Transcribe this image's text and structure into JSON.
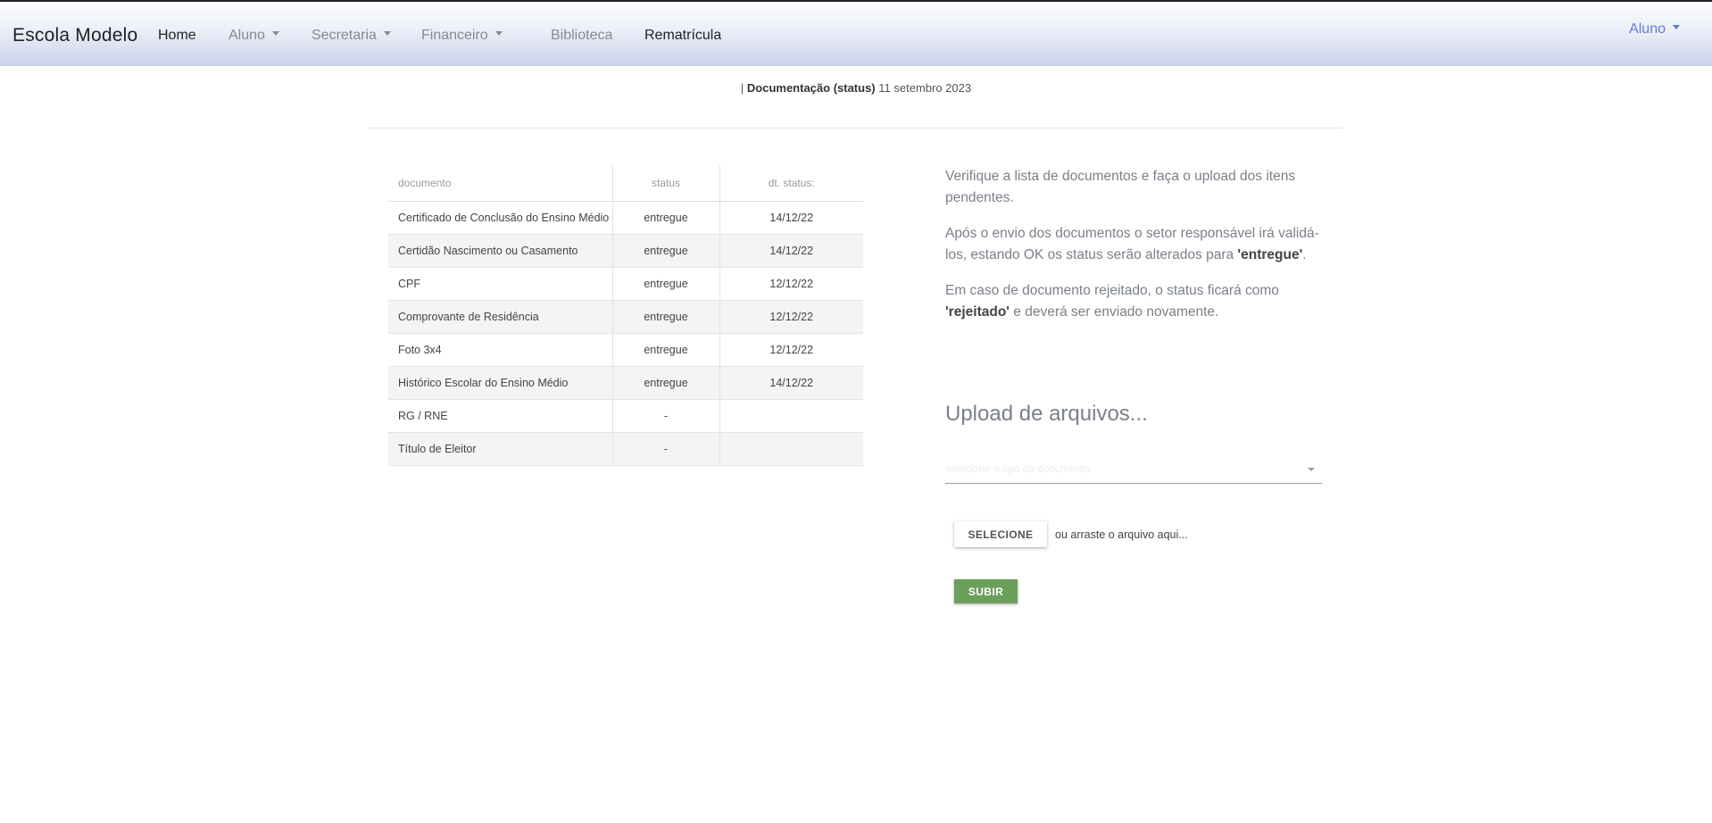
{
  "navbar": {
    "brand": "Escola Modelo",
    "items": [
      {
        "label": "Home"
      },
      {
        "label": "Aluno"
      },
      {
        "label": "Secretaria"
      },
      {
        "label": "Financeiro"
      },
      {
        "label": "Biblioteca"
      },
      {
        "label": "Rematrícula"
      }
    ],
    "user_menu": "Aluno"
  },
  "subheader": {
    "separator": "|",
    "title": "Documentação (status)",
    "date": "11 setembro 2023"
  },
  "table": {
    "headers": [
      "documento",
      "status",
      "dt. status:"
    ],
    "rows": [
      {
        "documento": "Certificado de Conclusão do Ensino Médio",
        "status": "entregue",
        "dt": "14/12/22"
      },
      {
        "documento": "Certidão Nascimento ou Casamento",
        "status": "entregue",
        "dt": "14/12/22"
      },
      {
        "documento": "CPF",
        "status": "entregue",
        "dt": "12/12/22"
      },
      {
        "documento": "Comprovante de Residência",
        "status": "entregue",
        "dt": "12/12/22"
      },
      {
        "documento": "Foto 3x4",
        "status": "entregue",
        "dt": "12/12/22"
      },
      {
        "documento": "Histórico Escolar do Ensino Médio",
        "status": "entregue",
        "dt": "14/12/22"
      },
      {
        "documento": "RG / RNE",
        "status": "-",
        "dt": ""
      },
      {
        "documento": "Título de Eleitor",
        "status": "-",
        "dt": ""
      }
    ]
  },
  "info": {
    "p1": "Verifique a lista de documentos e faça o upload dos itens pendentes.",
    "p2_pre": "Após o envio dos documentos o setor responsável irá validá-los, estando OK os status serão alterados para ",
    "p2_bold": "'entregue'",
    "p2_post": ".",
    "p3_pre": "Em caso de documento rejeitado, o status ficará como ",
    "p3_bold": "'rejeitado'",
    "p3_post": " e deverá ser enviado novamente."
  },
  "upload": {
    "title": "Upload de arquivos...",
    "select_placeholder": "selecione o tipo de documento",
    "select_button": "SELECIONE",
    "drag_text": "ou arraste o arquivo aqui...",
    "submit_button": "SUBIR"
  },
  "colors": {
    "accent_user": "#5f7fc9",
    "submit_green": "#6aa05b"
  }
}
